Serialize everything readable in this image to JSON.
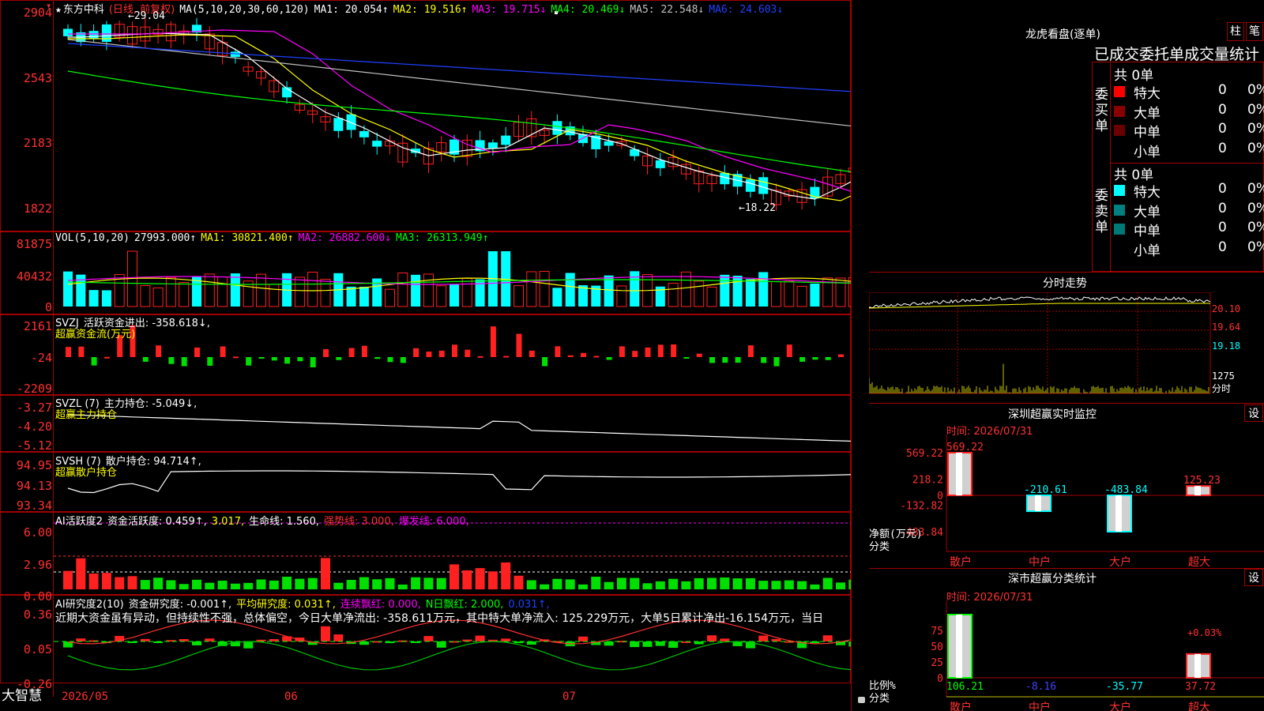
{
  "stock": {
    "name": "东方中科",
    "mode": "(日线, 前复权)"
  },
  "main_indicator": {
    "label": "MA(5,10,20,30,60,120)",
    "items": [
      {
        "t": "MA1: 20.054↑",
        "c": "#ffffff"
      },
      {
        "t": "MA2: 19.516↑",
        "c": "#ffff00"
      },
      {
        "t": "MA3: 19.715↓",
        "c": "#ff00ff"
      },
      {
        "t": "MA4: 20.469↓",
        "c": "#00ff00"
      },
      {
        "t": "MA5: 22.548↓",
        "c": "#c0c0c0"
      },
      {
        "t": "MA6: 24.603↓",
        "c": "#2040ff"
      }
    ],
    "y_ticks": [
      "2904",
      "2543",
      "2183",
      "1822"
    ],
    "high_label": "29.04",
    "low_label": "18.22"
  },
  "vol": {
    "label": "VOL(5,10,20)",
    "items": [
      {
        "t": "27993.000↑",
        "c": "#ffffff"
      },
      {
        "t": "MA1: 30821.400↑",
        "c": "#ffff00"
      },
      {
        "t": "MA2: 26882.600↓",
        "c": "#ff00ff"
      },
      {
        "t": "MA3: 26313.949↑",
        "c": "#00ff00"
      }
    ],
    "y_ticks": [
      "81875",
      "40432",
      "0"
    ]
  },
  "svzj": {
    "label": "SVZJ",
    "items": [
      {
        "t": "活跃资金进出: -358.618↓,",
        "c": "#ffffff"
      }
    ],
    "subtitle": "超赢资金流(万元)",
    "y_ticks": [
      "2161",
      "-24",
      "-2209"
    ]
  },
  "svzl": {
    "label": "SVZL (7)",
    "items": [
      {
        "t": "主力持仓: -5.049↓,",
        "c": "#ffffff"
      }
    ],
    "subtitle": "超赢主力持仓",
    "y_ticks": [
      "-3.27",
      "-4.20",
      "-5.12"
    ]
  },
  "svsh": {
    "label": "SVSH (7)",
    "items": [
      {
        "t": "散户持仓: 94.714↑,",
        "c": "#ffffff"
      }
    ],
    "subtitle": "超赢散户持仓",
    "y_ticks": [
      "94.95",
      "94.13",
      "93.34"
    ]
  },
  "ai1": {
    "label": "AI活跃度2",
    "items": [
      {
        "t": "资金活跃度: 0.459↑,",
        "c": "#ffffff"
      },
      {
        "t": "3.017,",
        "c": "#ffff00"
      },
      {
        "t": "生命线: 1.560,",
        "c": "#ffffff"
      },
      {
        "t": "强势线: 3.000,",
        "c": "#ff3030"
      },
      {
        "t": "爆发线: 6.000,",
        "c": "#ff00ff"
      }
    ],
    "y_ticks": [
      "6.00",
      "2.96",
      "0.00"
    ]
  },
  "ai2": {
    "label": "AI研究度2(10)",
    "items": [
      {
        "t": "资金研究度: -0.001↑,",
        "c": "#ffffff"
      },
      {
        "t": "平均研究度: 0.031↑,",
        "c": "#ffff00"
      },
      {
        "t": "连续飘红: 0.000,",
        "c": "#ff00ff"
      },
      {
        "t": "N日飘红: 2.000,",
        "c": "#00ff00"
      },
      {
        "t": "0.031↑,",
        "c": "#2040ff"
      }
    ],
    "comment": "近期大资金虽有异动，但持续性不强，总体偏空，今日大单净流出: -358.611万元，其中特大单净流入: 125.229万元，大单5日累计净出-16.154万元，当日",
    "y_ticks": [
      "0.36",
      "0.05",
      "-0.26"
    ]
  },
  "x_axis": [
    "2026/05",
    "06",
    "07"
  ],
  "brand": "大智慧",
  "lhb": {
    "title": "龙虎看盘(逐单)",
    "btn_bar": "柱",
    "btn_pen": "笔",
    "subtitle": "已成交委托单成交量统计",
    "buy_total": "共 0单",
    "buy_side": "委买单",
    "sell_total": "共 0单",
    "sell_side": "委卖单",
    "buy_rows": [
      {
        "n": "特大",
        "v": "0",
        "p": "0%",
        "c": "#ff0000"
      },
      {
        "n": "大单",
        "v": "0",
        "p": "0%",
        "c": "#8a0000"
      },
      {
        "n": "中单",
        "v": "0",
        "p": "0%",
        "c": "#6a0000"
      },
      {
        "n": "小单",
        "v": "0",
        "p": "0%",
        "c": "#000000"
      }
    ],
    "sell_rows": [
      {
        "n": "特大",
        "v": "0",
        "p": "0%",
        "c": "#00ffff"
      },
      {
        "n": "大单",
        "v": "0",
        "p": "0%",
        "c": "#008080"
      },
      {
        "n": "中单",
        "v": "0",
        "p": "0%",
        "c": "#007878"
      },
      {
        "n": "小单",
        "v": "0",
        "p": "0%",
        "c": "#000000"
      }
    ]
  },
  "fenshi": {
    "title": "分时走势",
    "y_ticks": [
      "20.10",
      "19.64",
      "19.18"
    ],
    "vol_label": "1275",
    "vol_unit": "分时"
  },
  "monitor": {
    "title": "深圳超赢实时监控",
    "btn": "设",
    "time": "时间: 2026/07/31",
    "y_ticks": [
      "569.22",
      "218.2",
      "0",
      "-132.82",
      "-483.84"
    ],
    "unit": "净额(万元)",
    "cat_title": "分类",
    "categories": [
      "散户",
      "中户",
      "大户",
      "超大"
    ],
    "values": [
      "569.22",
      "-210.61",
      "-483.84",
      "125.23"
    ]
  },
  "classify": {
    "title": "深市超赢分类统计",
    "btn": "设",
    "time": "时间: 2026/07/31",
    "y_ticks": [
      "75",
      "50",
      "25",
      "0"
    ],
    "unit": "比例%",
    "cat_title": "分类",
    "categories": [
      "散户",
      "中户",
      "大户",
      "超大"
    ],
    "values": [
      "106.21",
      "-8.16",
      "-35.77",
      "37.72"
    ],
    "annot": "+0.03%"
  },
  "chart_data": [
    {
      "type": "bar",
      "title": "超赢分类统计",
      "categories": [
        "散户",
        "中户",
        "大户",
        "超大"
      ],
      "values": [
        106.21,
        -8.16,
        -35.77,
        37.72
      ],
      "ylim": [
        0,
        100
      ],
      "ylabel": "比例%"
    },
    {
      "type": "bar",
      "title": "超赢实时监控",
      "categories": [
        "散户",
        "中户",
        "大户",
        "超大"
      ],
      "values": [
        569.22,
        -210.61,
        -483.84,
        125.23
      ],
      "ylim": [
        -483.84,
        569.22
      ],
      "ylabel": "净额(万元)"
    }
  ]
}
